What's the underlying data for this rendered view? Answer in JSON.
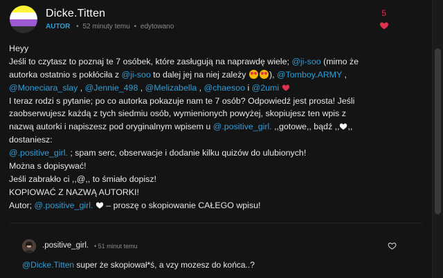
{
  "post": {
    "author": "Dicke.Titten",
    "badge": "AUTOR",
    "time": "52 minuty temu",
    "edited": "edytowano",
    "like_count": "5",
    "lines": [
      [
        {
          "t": "Heyy"
        }
      ],
      [
        {
          "t": "Jeśli to czytasz to poznaj te 7 osóbek, które zasługują na naprawdę wiele; "
        },
        {
          "m": "@ji-soo"
        },
        {
          "t": " (mimo że"
        }
      ],
      [
        {
          "t": "autorka ostatnio s pokłóciła z "
        },
        {
          "m": "@ji-soo"
        },
        {
          "t": " to dalej jej na niej zależy "
        },
        {
          "e": "star-eyes-emoji"
        },
        {
          "e": "star-eyes-emoji"
        },
        {
          "t": "), "
        },
        {
          "m": "@Tomboy.ARMY"
        },
        {
          "t": " ,"
        }
      ],
      [
        {
          "m": "@Moneciara_slay"
        },
        {
          "t": " , "
        },
        {
          "m": "@Jennie_498"
        },
        {
          "t": " , "
        },
        {
          "m": "@Melizabella"
        },
        {
          "t": " , "
        },
        {
          "m": "@chaesoo"
        },
        {
          "t": " i "
        },
        {
          "m": "@2umi"
        },
        {
          "t": " "
        },
        {
          "h": "red"
        }
      ],
      [
        {
          "t": "I teraz rodzi s pytanie; po co autorka pokazuje nam te 7 osób? Odpowiedź jest prosta! Jeśli"
        }
      ],
      [
        {
          "t": "zaobserwujesz każdą z tych siedmiu osób, wymienionych powyżej, skopiujesz ten wpis z"
        }
      ],
      [
        {
          "t": "nazwą autorki i napiszesz pod oryginalnym wpisem u "
        },
        {
          "m": "@.positive_girl."
        },
        {
          "t": " ,,gotowe,, bądź ,,"
        },
        {
          "h": "white"
        },
        {
          "t": ",,"
        }
      ],
      [
        {
          "t": "dostaniesz:"
        }
      ],
      [
        {
          "m": "@.positive_girl."
        },
        {
          "t": " ; spam serc, obserwacje i dodanie kilku quizów do ulubionych!"
        }
      ],
      [
        {
          "t": "Można s dopisywać!"
        }
      ],
      [
        {
          "t": "Jeśli zabrakło ci ,,@,, to śmiało dopisz!"
        }
      ],
      [
        {
          "t": "KOPIOWAĆ Z NAZWĄ AUTORKI!"
        }
      ],
      [
        {
          "t": "Autor; "
        },
        {
          "m": "@.positive_girl."
        },
        {
          "t": " "
        },
        {
          "h": "white"
        },
        {
          "t": "  – proszę o skopiowanie CAŁEGO wpisu!"
        }
      ]
    ]
  },
  "comment": {
    "author": ".positive_girl.",
    "time": "51 minut temu",
    "mention": "@Dicke.Titten",
    "text": " super że skopiował*ś, a vzy mozesz do końca..?"
  },
  "colors": {
    "mention": "#2f9ed8",
    "heart_red": "#e0304d",
    "background": "#141414"
  }
}
